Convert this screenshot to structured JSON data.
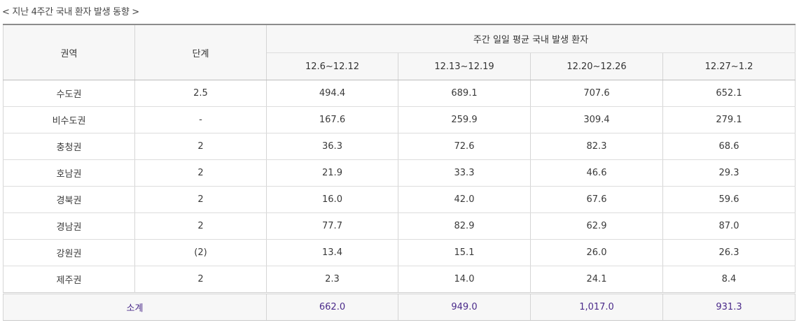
{
  "caption": "< 지난 4주간 국내 환자 발생 동향 >",
  "header": {
    "region_label": "권역",
    "level_label": "단계",
    "group_label": "주간 일일 평균 국내 발생 환자",
    "weeks": [
      "12.6~12.12",
      "12.13~12.19",
      "12.20~12.26",
      "12.27~1.2"
    ]
  },
  "rows": [
    {
      "region": "수도권",
      "level": "2.5",
      "values": [
        "494.4",
        "689.1",
        "707.6",
        "652.1"
      ]
    },
    {
      "region": "비수도권",
      "level": "-",
      "values": [
        "167.6",
        "259.9",
        "309.4",
        "279.1"
      ]
    },
    {
      "region": "충청권",
      "level": "2",
      "values": [
        "36.3",
        "72.6",
        "82.3",
        "68.6"
      ]
    },
    {
      "region": "호남권",
      "level": "2",
      "values": [
        "21.9",
        "33.3",
        "46.6",
        "29.3"
      ]
    },
    {
      "region": "경북권",
      "level": "2",
      "values": [
        "16.0",
        "42.0",
        "67.6",
        "59.6"
      ]
    },
    {
      "region": "경남권",
      "level": "2",
      "values": [
        "77.7",
        "82.9",
        "62.9",
        "87.0"
      ]
    },
    {
      "region": "강원권",
      "level": "(2)",
      "values": [
        "13.4",
        "15.1",
        "26.0",
        "26.3"
      ]
    },
    {
      "region": "제주권",
      "level": "2",
      "values": [
        "2.3",
        "14.0",
        "24.1",
        "8.4"
      ]
    }
  ],
  "total": {
    "label": "소계",
    "values": [
      "662.0",
      "949.0",
      "1,017.0",
      "931.3"
    ]
  },
  "colors": {
    "header_bg": "#f7f7f7",
    "total_text": "#4a2a8a",
    "top_border": "#8c8c8c"
  }
}
